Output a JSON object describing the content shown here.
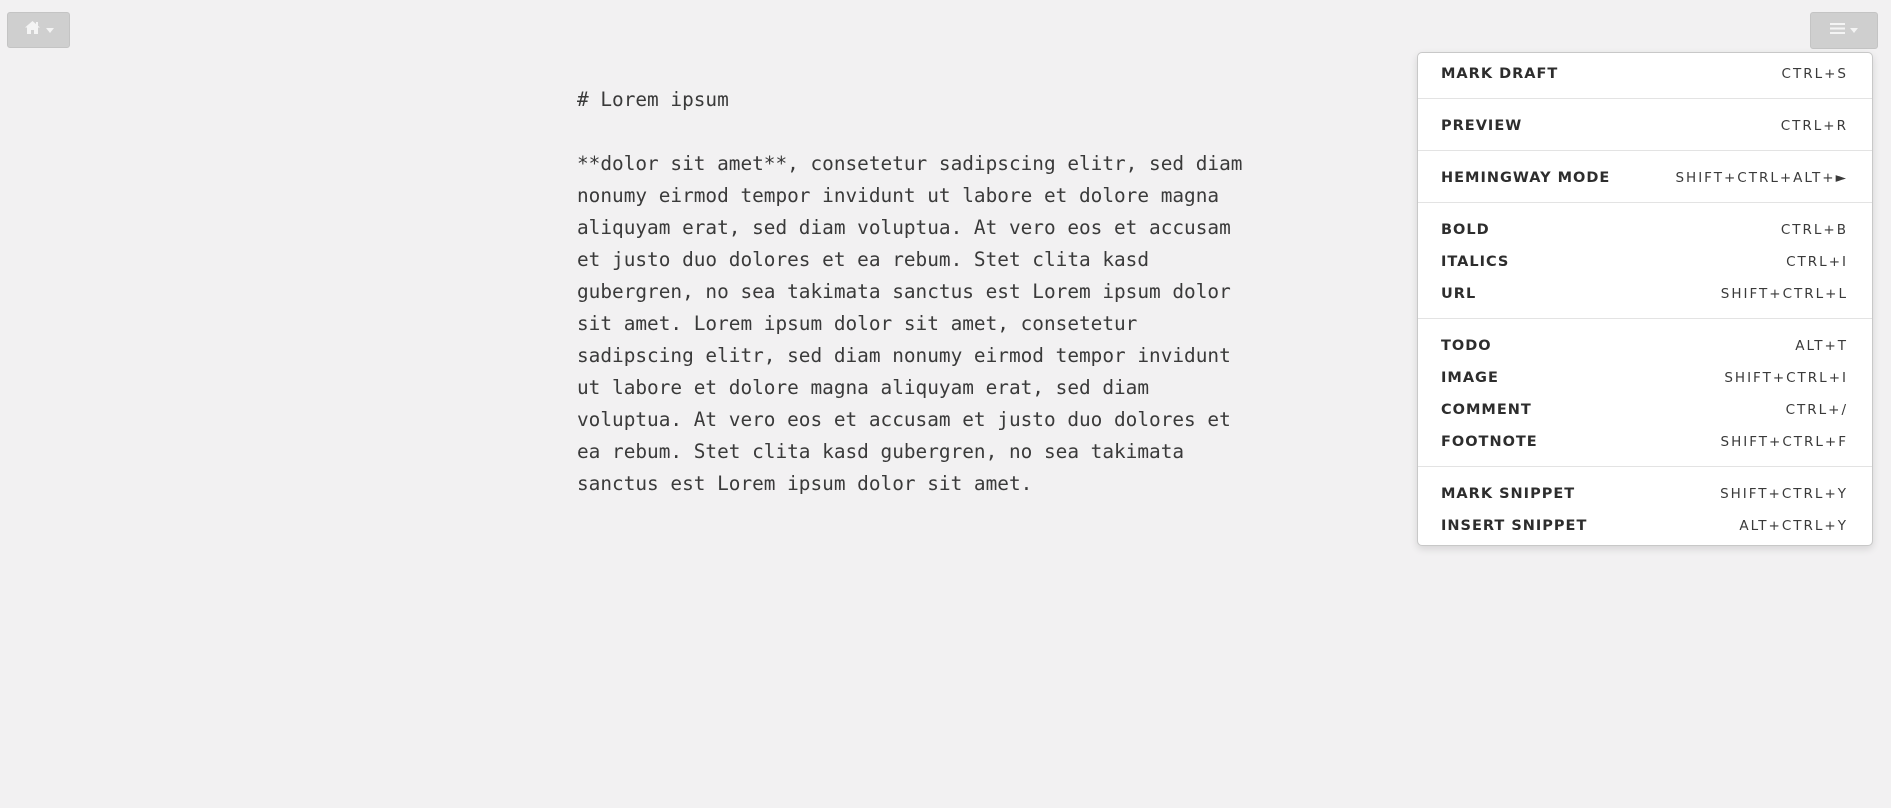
{
  "toolbar": {
    "home_icon": "home-icon",
    "menu_icon": "hamburger-icon"
  },
  "editor": {
    "heading": "# Lorem ipsum",
    "paragraph": "**dolor sit amet**, consetetur sadipscing elitr, sed diam nonumy eirmod tempor invidunt ut labore et dolore magna aliquyam erat, sed diam voluptua. At vero eos et accusam et justo duo dolores et ea rebum. Stet clita kasd gubergren, no sea takimata sanctus est Lorem ipsum dolor sit amet. Lorem ipsum dolor sit amet, consetetur sadipscing elitr, sed diam nonumy eirmod tempor invidunt ut labore et dolore magna aliquyam erat, sed diam voluptua. At vero eos et accusam et justo duo dolores et ea rebum. Stet clita kasd gubergren, no sea takimata sanctus est Lorem ipsum dolor sit amet.",
    "paragraph_lines": [
      "**dolor sit amet**, consetetur sadipscing elitr, sed diam",
      "nonumy eirmod tempor invidunt ut labore et dolore magna",
      "aliquyam erat, sed diam voluptua. At vero eos et accusam",
      "et justo duo dolores et ea rebum. Stet clita kasd",
      "gubergren, no sea takimata sanctus est Lorem ipsum dolor",
      "sit amet. Lorem ipsum dolor sit amet, consetetur",
      "sadipscing elitr, sed diam nonumy eirmod tempor invidunt",
      "ut labore et dolore magna aliquyam erat, sed diam",
      "voluptua. At vero eos et accusam et justo duo dolores et",
      "ea rebum. Stet clita kasd gubergren, no sea takimata",
      "sanctus est Lorem ipsum dolor sit amet."
    ]
  },
  "menu": {
    "items": [
      {
        "label": "MARK DRAFT",
        "shortcut": "CTRL+S"
      },
      {
        "label": "PREVIEW",
        "shortcut": "CTRL+R"
      },
      {
        "label": "HEMINGWAY MODE",
        "shortcut": "SHIFT+CTRL+ALT+►"
      },
      {
        "label": "BOLD",
        "shortcut": "CTRL+B"
      },
      {
        "label": "ITALICS",
        "shortcut": "CTRL+I"
      },
      {
        "label": "URL",
        "shortcut": "SHIFT+CTRL+L"
      },
      {
        "label": "TODO",
        "shortcut": "ALT+T"
      },
      {
        "label": "IMAGE",
        "shortcut": "SHIFT+CTRL+I"
      },
      {
        "label": "COMMENT",
        "shortcut": "CTRL+/"
      },
      {
        "label": "FOOTNOTE",
        "shortcut": "SHIFT+CTRL+F"
      },
      {
        "label": "MARK SNIPPET",
        "shortcut": "SHIFT+CTRL+Y"
      },
      {
        "label": "INSERT SNIPPET",
        "shortcut": "ALT+CTRL+Y"
      }
    ]
  },
  "colors": {
    "background": "#f2f1f2",
    "button": "#cfcfcf",
    "text": "#3a3a3a",
    "menu_bg": "#ffffff"
  }
}
